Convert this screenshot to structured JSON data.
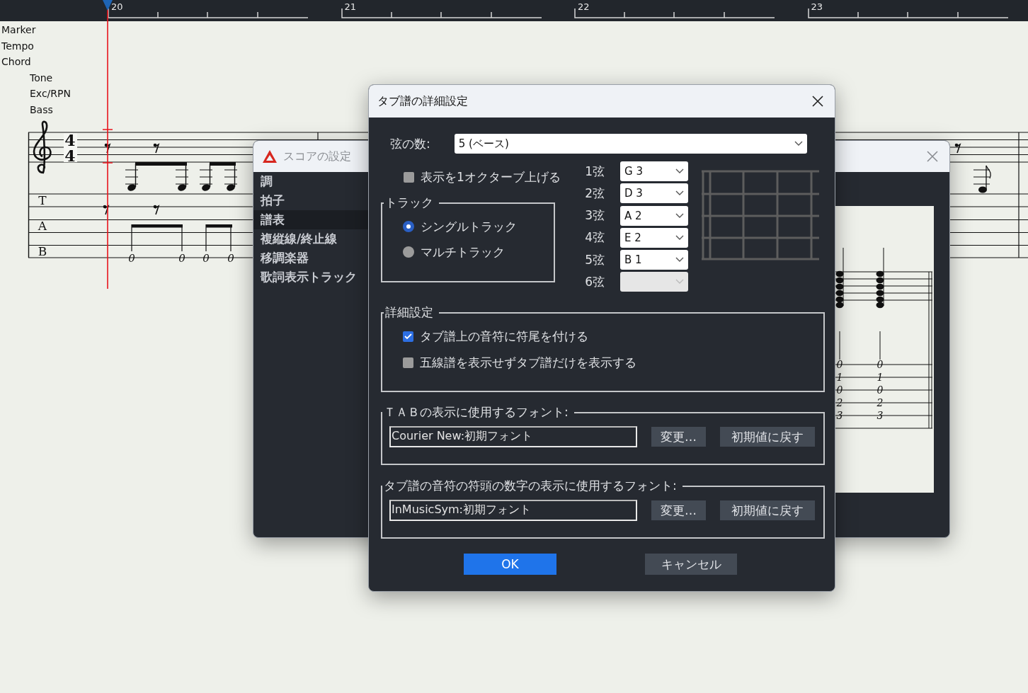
{
  "ruler": {
    "measures": [
      "20",
      "21",
      "22",
      "23"
    ]
  },
  "tracks": [
    "Marker",
    "Tempo",
    "Chord"
  ],
  "parts": [
    "Tone",
    "Exc/RPN",
    "Bass"
  ],
  "score": {
    "time_signature": [
      "4",
      "4"
    ],
    "tab_letters": [
      "T",
      "A",
      "B"
    ],
    "tab_numbers": [
      "0",
      "0",
      "0",
      "0"
    ]
  },
  "score_settings_window": {
    "title": "スコアの設定",
    "sidebar": [
      {
        "label": "調",
        "selected": false
      },
      {
        "label": "拍子",
        "selected": false
      },
      {
        "label": "譜表",
        "selected": true
      },
      {
        "label": "複縦線/終止線",
        "selected": false
      },
      {
        "label": "移調楽器",
        "selected": false
      },
      {
        "label": "歌詞表示トラック",
        "selected": false
      }
    ],
    "preview": {
      "tab_columns": [
        [
          "0",
          "1",
          "0",
          "2",
          "3"
        ],
        [
          "0",
          "1",
          "0",
          "2",
          "3"
        ]
      ]
    }
  },
  "tab_dialog": {
    "title": "タブ譜の詳細設定",
    "string_count": {
      "label": "弦の数:",
      "value": "5 (ベース)"
    },
    "raise_octave": {
      "label": "表示を1オクターブ上げる",
      "checked": false
    },
    "track": {
      "legend": "トラック",
      "options": [
        {
          "label": "シングルトラック",
          "selected": true
        },
        {
          "label": "マルチトラック",
          "selected": false
        }
      ]
    },
    "strings": [
      {
        "label": "1弦",
        "value": "G 3",
        "disabled": false
      },
      {
        "label": "2弦",
        "value": "D 3",
        "disabled": false
      },
      {
        "label": "3弦",
        "value": "A 2",
        "disabled": false
      },
      {
        "label": "4弦",
        "value": "E 2",
        "disabled": false
      },
      {
        "label": "5弦",
        "value": "B 1",
        "disabled": false
      },
      {
        "label": "6弦",
        "disabled": true
      }
    ],
    "details": {
      "legend": "詳細設定",
      "options": [
        {
          "label": "タブ譜上の音符に符尾を付ける",
          "checked": true
        },
        {
          "label": "五線譜を表示せずタブ譜だけを表示する",
          "checked": false
        }
      ]
    },
    "fonts": [
      {
        "legend": "ＴＡＢの表示に使用するフォント:",
        "value": "Courier New:初期フォント",
        "change": "変更…",
        "reset": "初期値に戻す"
      },
      {
        "legend": "タブ譜の音符の符頭の数字の表示に使用するフォント:",
        "value": "InMusicSym:初期フォント",
        "change": "変更…",
        "reset": "初期値に戻す"
      }
    ],
    "buttons": [
      {
        "label": "OK",
        "kind": "primary"
      },
      {
        "label": "キャンセル",
        "kind": "secondary"
      }
    ]
  }
}
